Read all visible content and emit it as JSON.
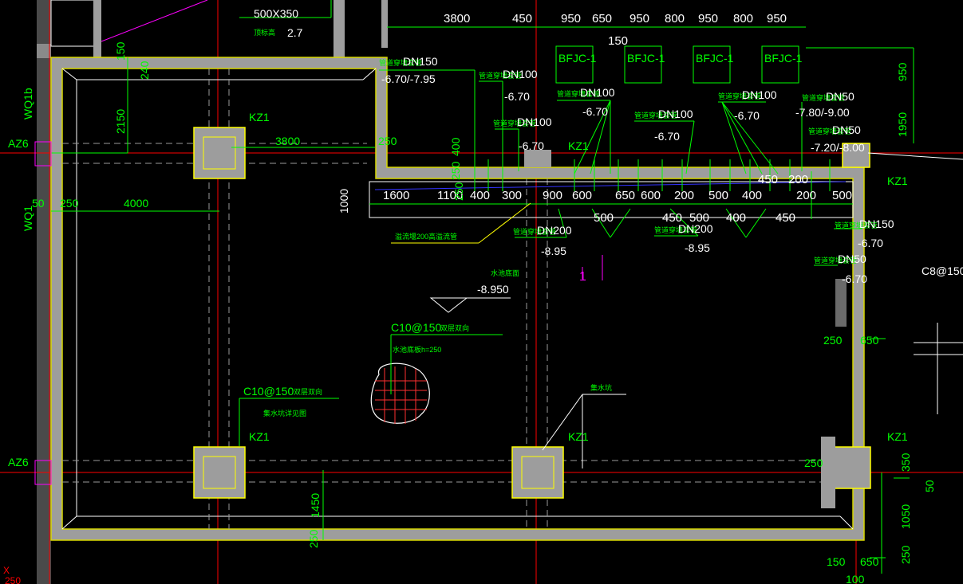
{
  "colors": {
    "background": "#000000",
    "grid": "#ff0000",
    "wall": "#9d9d9d",
    "outline": "#ffff00",
    "dim": "#00ff00",
    "text": "#ffffff",
    "axis": "#ff00ff"
  },
  "beam": {
    "size": "500X350",
    "note_cn": "顶标高",
    "elev": "2.7"
  },
  "top_dims": [
    "3800",
    "450",
    "950",
    "650",
    "950",
    "800",
    "950",
    "800",
    "950"
  ],
  "top_dim2": "150",
  "wall_labels": [
    "BFJC-1",
    "BFJC-1",
    "BFJC-1",
    "BFJC-1"
  ],
  "pipes": [
    {
      "id": "p1",
      "tag": "管道穿墙套管",
      "size": "DN150",
      "elev": "-6.70/-7.95"
    },
    {
      "id": "p2",
      "tag": "管道穿墙套管",
      "size": "DN100",
      "elev": "-6.70"
    },
    {
      "id": "p3",
      "tag": "管道穿墙套管",
      "size": "DN100",
      "elev": "-6.70"
    },
    {
      "id": "p4",
      "tag": "管道穿墙套管",
      "size": "DN100",
      "elev": "-6.70"
    },
    {
      "id": "p5",
      "tag": "管道穿墙套管",
      "size": "DN100",
      "elev": "-6.70"
    },
    {
      "id": "p6",
      "tag": "管道穿墙套管",
      "size": "DN100",
      "elev": "-6.70"
    },
    {
      "id": "p7",
      "tag": "管道穿墙套管",
      "size": "DN50",
      "elev": "-7.80/-9.00"
    },
    {
      "id": "p8",
      "tag": "管道穿墙套管",
      "size": "DN50",
      "elev": "-7.20/-8.00"
    },
    {
      "id": "p9",
      "tag": "管道穿墙套管",
      "size": "DN200",
      "elev": "-8.95"
    },
    {
      "id": "p10",
      "tag": "管道穿墙套管",
      "size": "DN200",
      "elev": "-8.95"
    },
    {
      "id": "p11",
      "tag": "管道穿墙套管",
      "size": "DN150",
      "elev": "-6.70"
    },
    {
      "id": "p12",
      "tag": "管道穿墙套管",
      "size": "DN50",
      "elev": "-6.70"
    }
  ],
  "columns": [
    "KZ1",
    "KZ1",
    "KZ1",
    "KZ1",
    "KZ1",
    "KZ1"
  ],
  "axes": [
    "AZ6",
    "AZ6",
    "WQ1b",
    "WQ1"
  ],
  "left_dims": [
    "150",
    "240",
    "2150",
    "3800",
    "250",
    "50",
    "250",
    "4000"
  ],
  "step_dims": [
    "1600",
    "1100",
    "400",
    "300",
    "900",
    "600",
    "650",
    "600",
    "200",
    "500",
    "400",
    "200",
    "500",
    "450",
    "200",
    "500",
    "450",
    "500",
    "400",
    "450",
    "250",
    "1000",
    "400",
    "250"
  ],
  "slab": {
    "elev_note": "水池底面",
    "elev": "-8.950",
    "rebar": "C10@150",
    "rebar_note": "双层双向",
    "thick_note": "水池底板h=250"
  },
  "pit": {
    "rebar": "C10@150",
    "rebar_note": "双层双向",
    "note": "集水坑详见图"
  },
  "side_dims": [
    "250",
    "650",
    "250",
    "350",
    "50",
    "1050",
    "250",
    "150",
    "650",
    "100",
    "950",
    "1950"
  ],
  "bottom_dims": [
    "1450",
    "250"
  ],
  "right_rebar": "C8@150",
  "section_mark": "1",
  "misc": {
    "drain_note": "集水坑",
    "sump_note": "溢流堰200高溢流管",
    "coord": "X",
    "coord2": "250"
  }
}
